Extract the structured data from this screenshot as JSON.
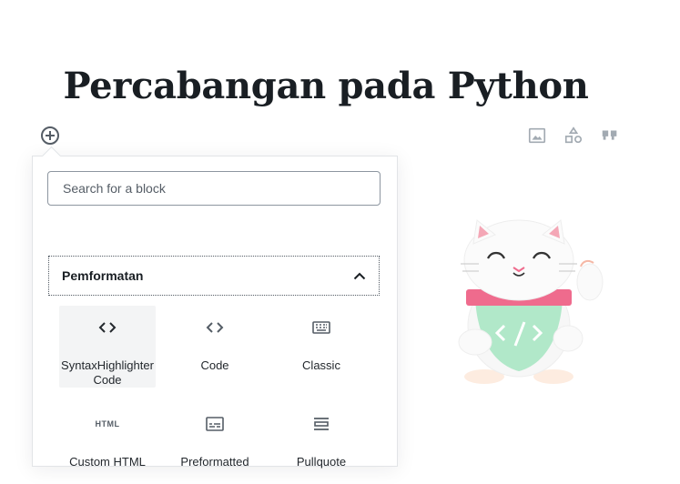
{
  "page": {
    "title": "Percabangan pada Python"
  },
  "inserter": {
    "toggle_icon": "plus-circle-icon",
    "search_placeholder": "Search for a block",
    "search_value": "",
    "panel": {
      "title": "Pemformatan",
      "expanded": true,
      "chevron_icon": "chevron-up-icon"
    },
    "blocks": [
      {
        "label": "SyntaxHighlighter Code",
        "icon": "code-icon",
        "active": true
      },
      {
        "label": "Code",
        "icon": "code-icon"
      },
      {
        "label": "Classic",
        "icon": "keyboard-icon"
      },
      {
        "label": "Custom HTML",
        "icon": "html-icon"
      },
      {
        "label": "Preformatted",
        "icon": "preformatted-icon"
      },
      {
        "label": "Pullquote",
        "icon": "pullquote-icon"
      }
    ],
    "html_icon_text": "HTML"
  },
  "toolbar": {
    "icons": [
      "image-icon",
      "shapes-icon",
      "quote-icon"
    ]
  },
  "colors": {
    "text": "#191e23",
    "icon": "#555d66",
    "border": "#8d96a0",
    "mascot_pink": "#ef6b8d",
    "mascot_green": "#a4e5c1"
  }
}
